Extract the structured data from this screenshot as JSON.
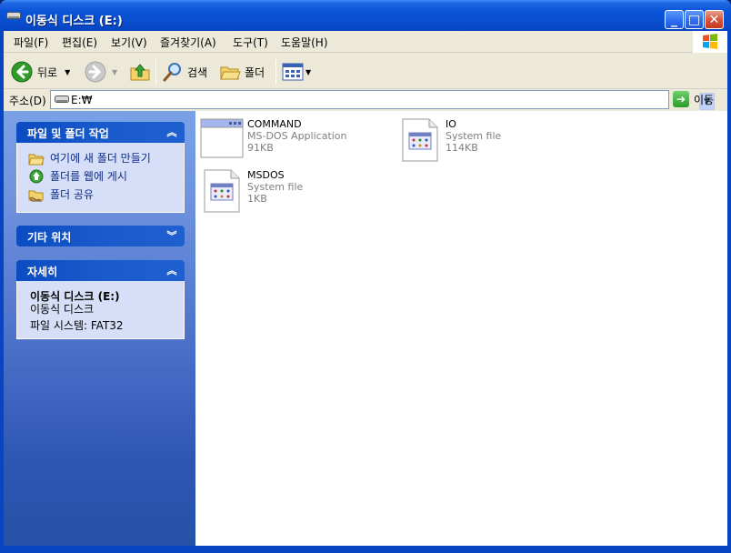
{
  "window": {
    "title": "이동식 디스크 (E:)"
  },
  "menu": [
    "파일(F)",
    "편집(E)",
    "보기(V)",
    "즐겨찾기(A)",
    "도구(T)",
    "도움말(H)"
  ],
  "toolbar": {
    "back": "뒤로",
    "search": "검색",
    "folders": "폴더"
  },
  "address": {
    "label": "주소(D)",
    "value": "E:₩",
    "go": "이동"
  },
  "taskpane": {
    "file_tasks": {
      "title": "파일 및 폴더 작업",
      "items": [
        "여기에 새 폴더 만들기",
        "폴더를 웹에 게시",
        "폴더 공유"
      ]
    },
    "other_places": {
      "title": "기타 위치"
    },
    "details": {
      "title": "자세히",
      "name": "이동식 디스크 (E:)",
      "type": "이동식 디스크",
      "fs": "파일 시스템: FAT32"
    }
  },
  "files": [
    {
      "name": "COMMAND",
      "type": "MS-DOS Application",
      "size": "91KB",
      "icon": "msdos-app-icon"
    },
    {
      "name": "IO",
      "type": "System file",
      "size": "114KB",
      "icon": "system-file-icon"
    },
    {
      "name": "MSDOS",
      "type": "System file",
      "size": "1KB",
      "icon": "system-file-icon"
    }
  ],
  "colors": {
    "title_blue": "#0a52d6",
    "pane_blue": "#6f93de",
    "link_blue": "#0c2d8a"
  }
}
